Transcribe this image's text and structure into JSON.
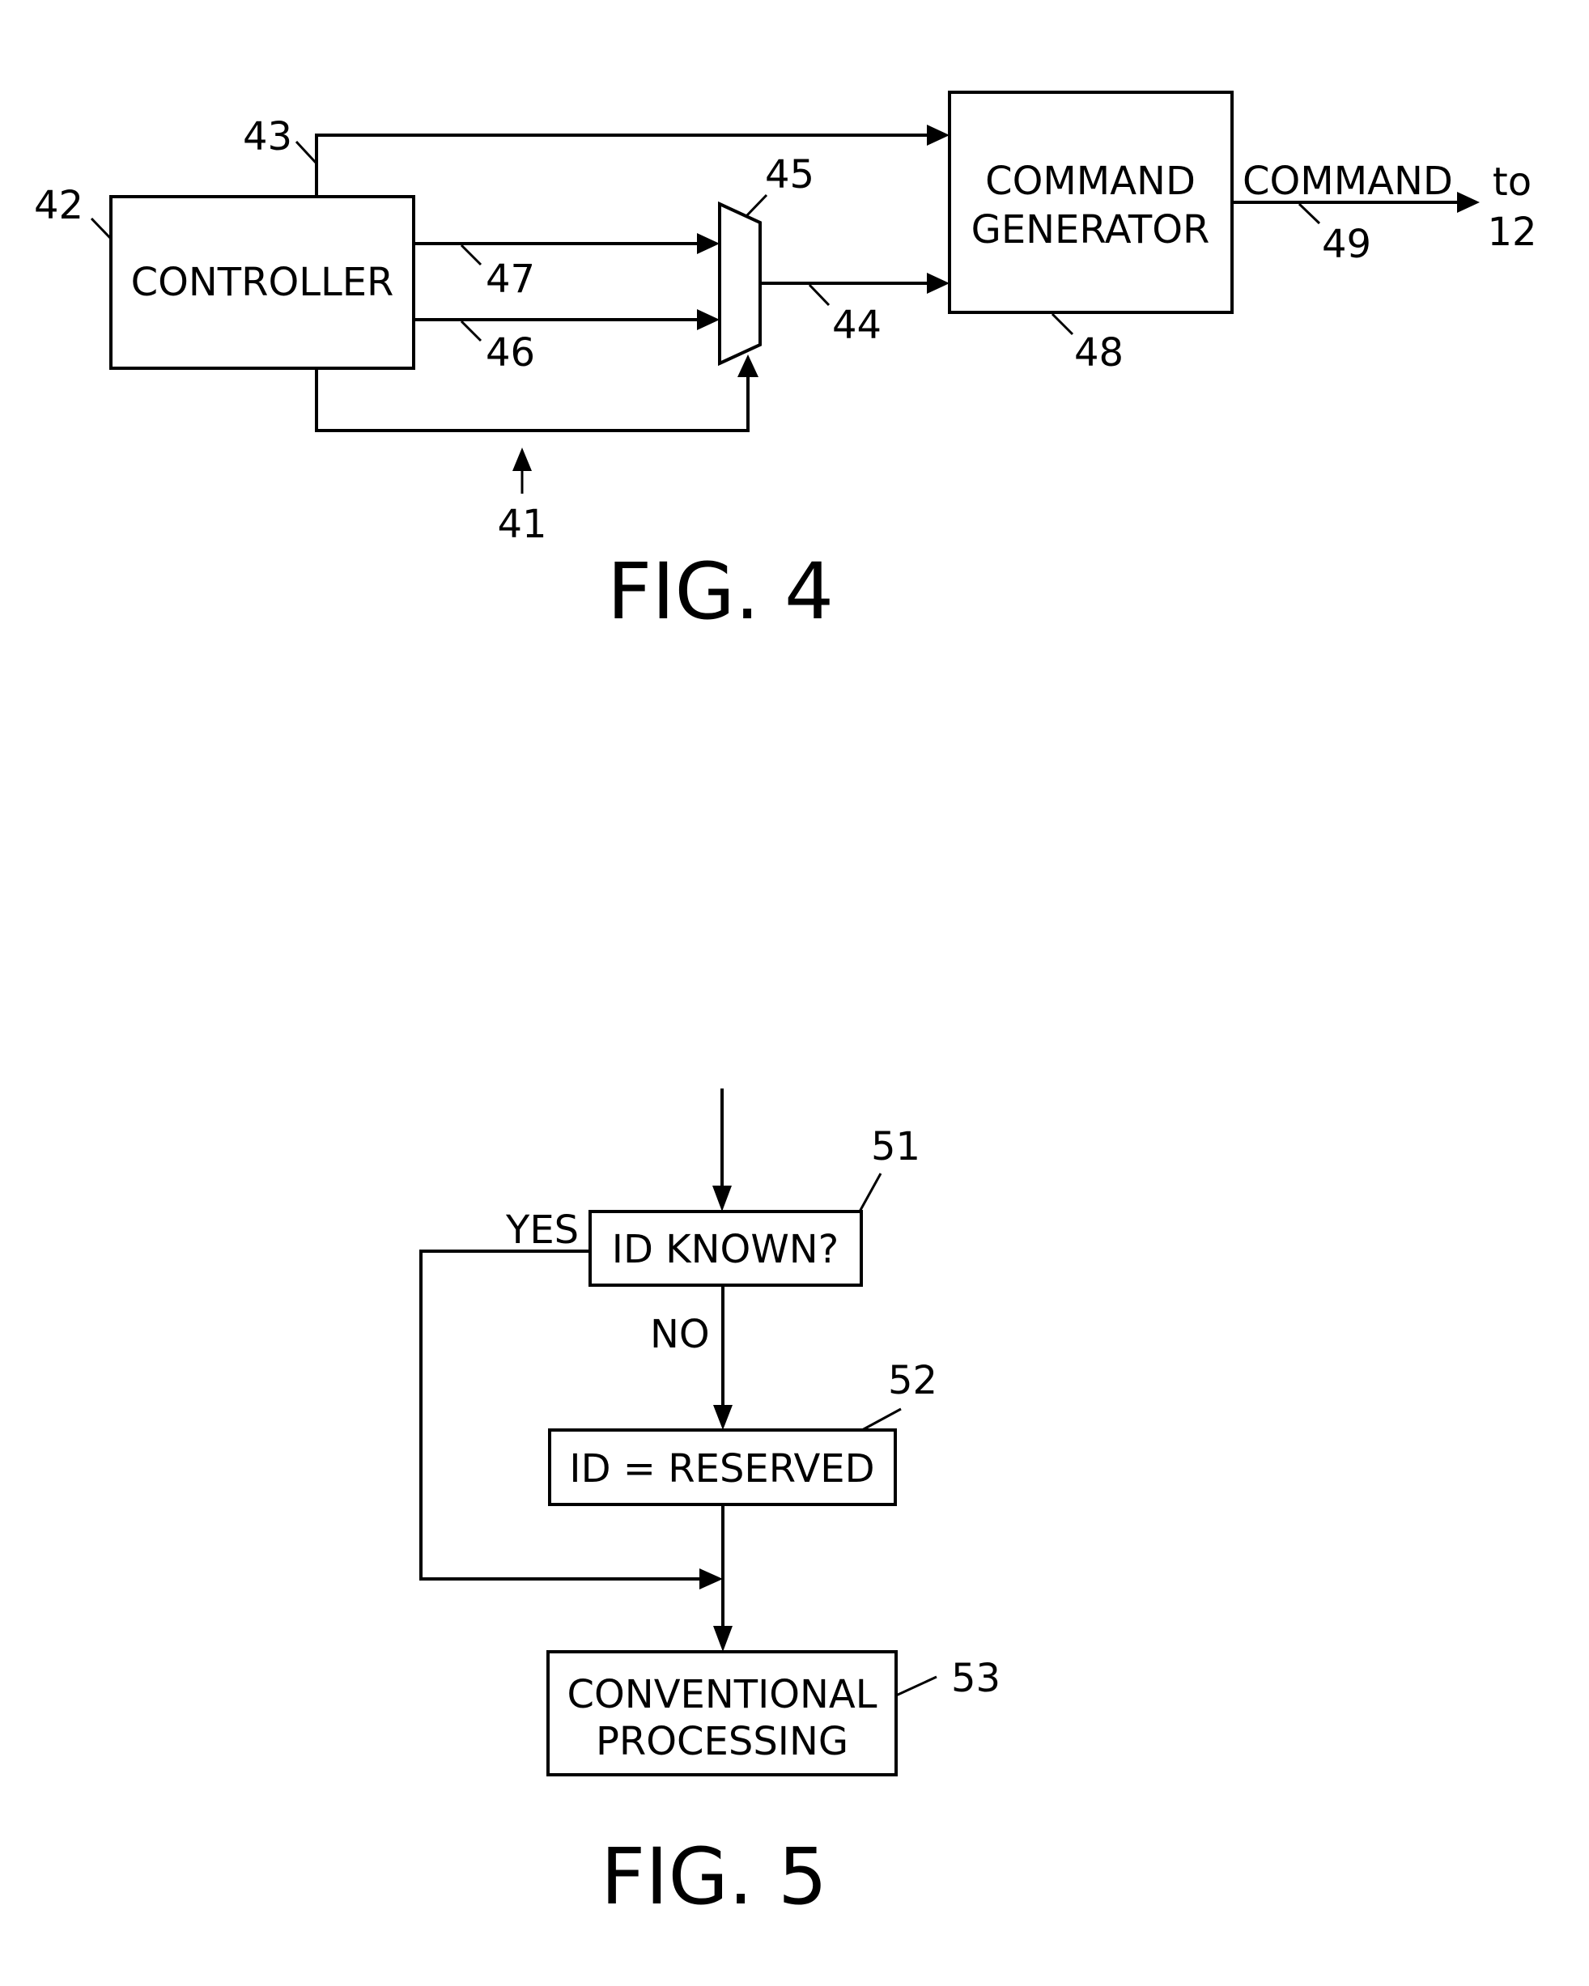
{
  "fig4": {
    "caption": "FIG. 4",
    "controller": {
      "label": "CONTROLLER",
      "ref": "42"
    },
    "command_generator": {
      "label_line1": "COMMAND",
      "label_line2": "GENERATOR",
      "ref": "48"
    },
    "multiplexer": {
      "ref": "45"
    },
    "signals": {
      "s41": "41",
      "s43": "43",
      "s44": "44",
      "s46": "46",
      "s47": "47",
      "s49": "49"
    },
    "output": {
      "label": "COMMAND",
      "dest_line1": "to",
      "dest_line2": "12"
    }
  },
  "fig5": {
    "caption": "FIG. 5",
    "steps": [
      {
        "ref": "51",
        "label": "ID KNOWN?"
      },
      {
        "ref": "52",
        "label": "ID = RESERVED"
      },
      {
        "ref": "53",
        "label_line1": "CONVENTIONAL",
        "label_line2": "PROCESSING"
      }
    ],
    "branches": {
      "yes": "YES",
      "no": "NO"
    }
  }
}
